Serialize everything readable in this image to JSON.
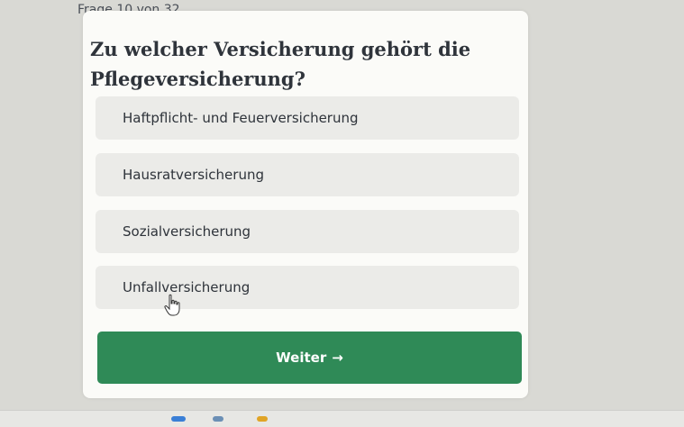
{
  "header": {
    "progress_label": "Frage 10 von 32"
  },
  "question": {
    "text": "Zu welcher Versicherung gehört die Pflegeversicherung?"
  },
  "options": [
    {
      "label": "Haftpflicht- und Feuerversicherung"
    },
    {
      "label": "Hausratversicherung"
    },
    {
      "label": "Sozialversicherung"
    },
    {
      "label": "Unfallversicherung"
    }
  ],
  "actions": {
    "next_label": "Weiter",
    "next_icon": "arrow-right-icon",
    "next_icon_glyph": "→"
  },
  "colors": {
    "accent": "#2f8a57",
    "option_bg": "#ebebe8",
    "card_bg": "#fbfbf8"
  },
  "cursor": {
    "icon": "hand-pointer-icon"
  }
}
